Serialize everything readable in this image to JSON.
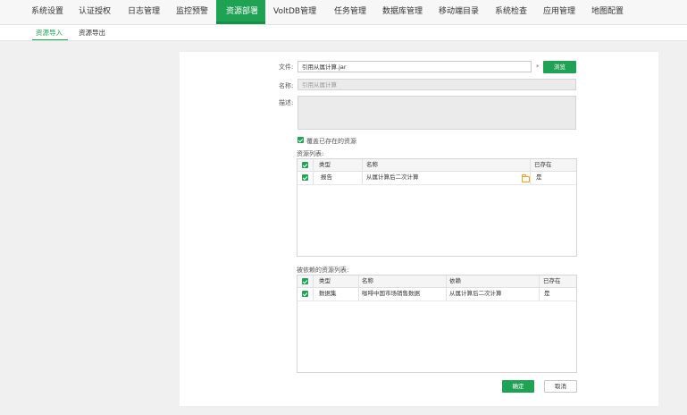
{
  "nav": {
    "items": [
      "系统设置",
      "认证授权",
      "日志管理",
      "监控预警",
      "资源部署",
      "VoltDB管理",
      "任务管理",
      "数据库管理",
      "移动端目录",
      "系统检查",
      "应用管理",
      "地图配置"
    ],
    "active_index": 4
  },
  "subnav": {
    "items": [
      "资源导入",
      "资源导出"
    ],
    "active_index": 0
  },
  "form": {
    "file_label": "文件:",
    "file_value": "引用从属计算.jar",
    "required_mark": "*",
    "browse_label": "浏览",
    "name_label": "名称:",
    "name_placeholder": "引用从属计算",
    "desc_label": "描述:",
    "overwrite_label": "覆盖已存在的资源",
    "resource_list_label": "资源列表:",
    "dep_list_label": "被依赖的资源列表:"
  },
  "resource_table": {
    "headers": [
      "类型",
      "名称",
      "已存在"
    ],
    "rows": [
      {
        "type": "报告",
        "name": "从属计算后二次计算",
        "exists": "是"
      }
    ]
  },
  "dep_table": {
    "headers": [
      "类型",
      "名称",
      "依赖",
      "已存在"
    ],
    "rows": [
      {
        "type": "数据集",
        "name": "咖啡中国市场销售数据",
        "dependency": "从属计算后二次计算",
        "exists": "是"
      }
    ]
  },
  "buttons": {
    "ok": "确定",
    "cancel": "取消"
  },
  "colors": {
    "accent": "#20a255"
  }
}
